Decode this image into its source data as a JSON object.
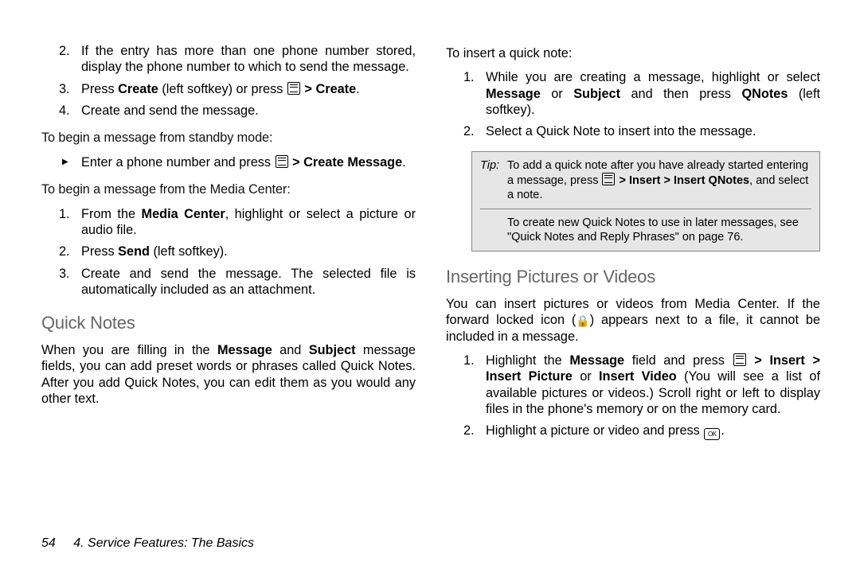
{
  "col1": {
    "list1": {
      "item2": {
        "n": "2.",
        "t": "If the entry has more than one phone number stored, display the phone number to which to send the message."
      },
      "item3": {
        "n": "3.",
        "t1": "Press ",
        "b1": "Create",
        "t2": " (left softkey) or press ",
        "t3": " > ",
        "b2": "Create",
        "t4": "."
      },
      "item4": {
        "n": "4.",
        "t": "Create and send the message."
      }
    },
    "lead1": "To begin a message from standby mode:",
    "arrow1": {
      "t1": "Enter a phone number and press ",
      "t2": " > ",
      "b1": "Create Message",
      "t3": "."
    },
    "lead2": "To begin a message from the Media Center:",
    "list2": {
      "item1": {
        "n": "1.",
        "t1": "From the ",
        "b1": "Media Center",
        "t2": ", highlight or select a picture or audio file."
      },
      "item2": {
        "n": "2.",
        "t1": "Press ",
        "b1": "Send",
        "t2": " (left softkey)."
      },
      "item3": {
        "n": "3.",
        "t": "Create and send the message. The selected file is automatically included as an attachment."
      }
    },
    "h_quick": "Quick Notes",
    "quick_p": {
      "t1": "When you are filling in the ",
      "b1": "Message",
      "t2": " and ",
      "b2": "Subject",
      "t3": " message fields, you can add preset words or phrases called Quick Notes. After you add Quick Notes, you can edit them as you would any other text."
    }
  },
  "col2": {
    "lead1": "To insert a quick note:",
    "list1": {
      "item1": {
        "n": "1.",
        "t1": "While you are creating a message, highlight or select ",
        "b1": "Message",
        "t2": " or ",
        "b2": "Subject",
        "t3": " and then press ",
        "b3": "QNotes",
        "t4": " (left softkey)."
      },
      "item2": {
        "n": "2.",
        "t": "Select a Quick Note to insert into the message."
      }
    },
    "tip": {
      "label": "Tip:",
      "row1": {
        "t1": "To add a quick note after you have already started entering a message, press ",
        "t2": " > ",
        "b1": "Insert",
        "t3": " > ",
        "b2": "Insert QNotes",
        "t4": ", and select a note."
      },
      "row2": "To create new Quick Notes to use in later messages, see \"Quick Notes and Reply Phrases\" on page 76."
    },
    "h_pics": "Inserting Pictures or Videos",
    "pics_p": {
      "t1": "You can insert pictures or videos from Media Center. If the forward locked icon (",
      "t2": ") appears next to a file, it cannot be included in a message."
    },
    "list2": {
      "item1": {
        "n": "1.",
        "t1": "Highlight the ",
        "b1": "Message",
        "t2": " field and press ",
        "t3": " > ",
        "b2": "Insert",
        "t4": " > ",
        "b3": "Insert Picture",
        "t5": " or ",
        "b4": "Insert Video",
        "t6": " (You will see a list of available pictures or videos.) Scroll right or left to display files in the phone's memory or on the memory card."
      },
      "item2": {
        "n": "2.",
        "t1": "Highlight a picture or video and press ",
        "t2": "."
      }
    }
  },
  "footer": {
    "page": "54",
    "section": "4. Service Features: The Basics"
  }
}
